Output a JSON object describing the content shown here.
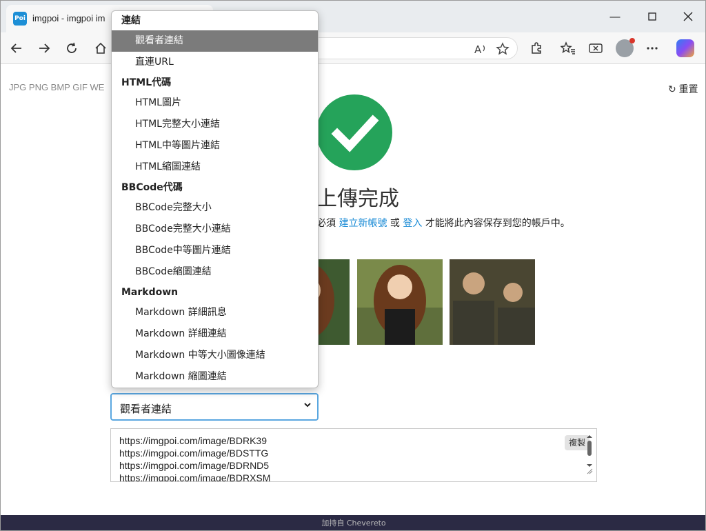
{
  "browser": {
    "tab_title": "imgpoi - imgpoi im",
    "favicon_text": "Poi"
  },
  "page": {
    "formats": "JPG PNG BMP GIF WE",
    "reset_label": "重置",
    "upload_title": "上傳完成",
    "notice_prefix": "必須",
    "notice_link1": "建立新帳號",
    "notice_or": "或",
    "notice_link2": "登入",
    "notice_suffix": "才能將此內容保存到您的帳戶中。",
    "selected_option": "觀看者連結",
    "copy_label": "複製",
    "links": [
      "https://imgpoi.com/image/BDRK39",
      "https://imgpoi.com/image/BDSTTG",
      "https://imgpoi.com/image/BDRND5",
      "https://imgpoi.com/image/BDRXSM"
    ],
    "footer": "加持自 Chevereto"
  },
  "dropdown": {
    "groups": [
      {
        "label": "連結",
        "items": [
          "觀看者連結",
          "直連URL"
        ]
      },
      {
        "label": "HTML代碼",
        "items": [
          "HTML圖片",
          "HTML完整大小連結",
          "HTML中等圖片連結",
          "HTML縮圖連結"
        ]
      },
      {
        "label": "BBCode代碼",
        "items": [
          "BBCode完整大小",
          "BBCode完整大小連結",
          "BBCode中等圖片連結",
          "BBCode縮圖連結"
        ]
      },
      {
        "label": "Markdown",
        "items": [
          "Markdown 詳細訊息",
          "Markdown 詳細連結",
          "Markdown 中等大小圖像連結",
          "Markdown 縮圖連結"
        ]
      }
    ]
  },
  "colors": {
    "success": "#25a35a",
    "link": "#1a8bd6",
    "selected_bg": "#7b7b7b",
    "focus_border": "#5aa7e0"
  }
}
